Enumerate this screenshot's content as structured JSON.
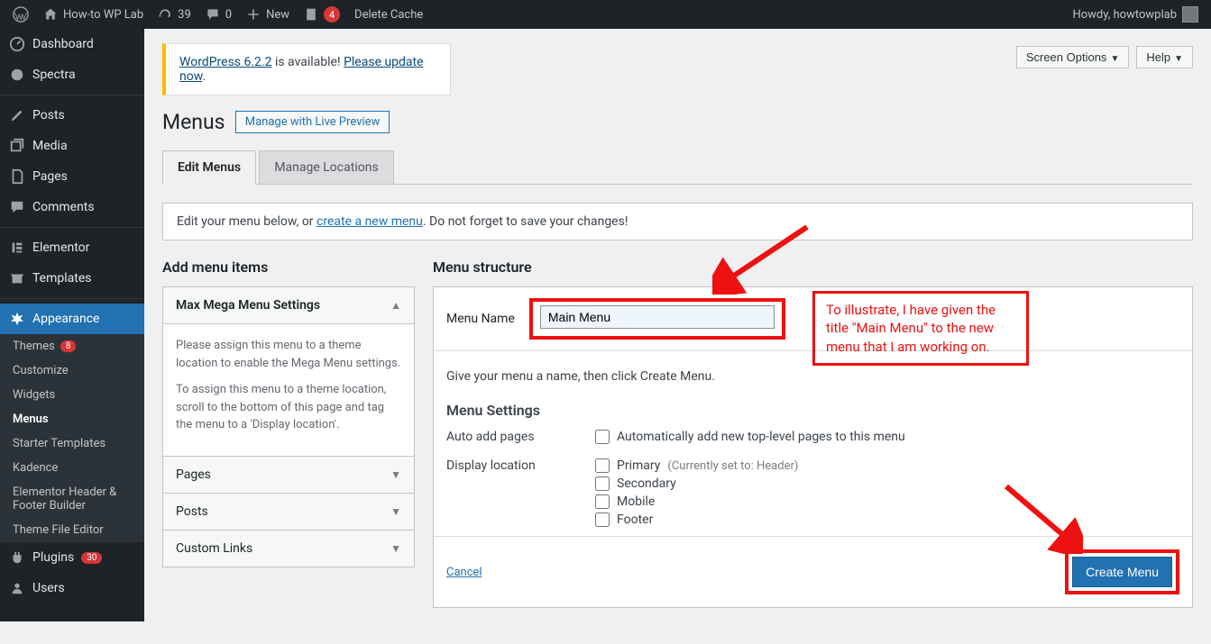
{
  "adminbar": {
    "site": "How-to WP Lab",
    "updates": "39",
    "comments": "0",
    "new": "New",
    "forms_badge": "4",
    "delete_cache": "Delete Cache",
    "howdy": "Howdy, howtowplab"
  },
  "sidebar": {
    "items": [
      {
        "label": "Dashboard"
      },
      {
        "label": "Spectra"
      },
      {
        "label": "Posts"
      },
      {
        "label": "Media"
      },
      {
        "label": "Pages"
      },
      {
        "label": "Comments"
      },
      {
        "label": "Elementor"
      },
      {
        "label": "Templates"
      },
      {
        "label": "Appearance"
      },
      {
        "label": "Plugins"
      },
      {
        "label": "Users"
      }
    ],
    "appearance_sub": [
      {
        "label": "Themes",
        "badge": "8"
      },
      {
        "label": "Customize"
      },
      {
        "label": "Widgets"
      },
      {
        "label": "Menus"
      },
      {
        "label": "Starter Templates"
      },
      {
        "label": "Kadence"
      },
      {
        "label": "Elementor Header & Footer Builder"
      },
      {
        "label": "Theme File Editor"
      }
    ],
    "plugins_badge": "30"
  },
  "top_buttons": {
    "screen_options": "Screen Options",
    "help": "Help"
  },
  "notice": {
    "link1": "WordPress 6.2.2",
    "mid": " is available! ",
    "link2": "Please update now",
    "end": "."
  },
  "page": {
    "title": "Menus",
    "live_preview": "Manage with Live Preview",
    "tabs": {
      "edit": "Edit Menus",
      "locations": "Manage Locations"
    },
    "infobar_pre": "Edit your menu below, or ",
    "infobar_link": "create a new menu",
    "infobar_post": ". Do not forget to save your changes!"
  },
  "left": {
    "title": "Add menu items",
    "mega_head": "Max Mega Menu Settings",
    "mega_p1": "Please assign this menu to a theme location to enable the Mega Menu settings.",
    "mega_p2": "To assign this menu to a theme location, scroll to the bottom of this page and tag the menu to a 'Display location'.",
    "acc": [
      "Pages",
      "Posts",
      "Custom Links"
    ]
  },
  "right": {
    "title": "Menu structure",
    "name_label": "Menu Name",
    "name_value": "Main Menu",
    "instr": "Give your menu a name, then click Create Menu.",
    "settings_title": "Menu Settings",
    "auto_label": "Auto add pages",
    "auto_opt": "Automatically add new top-level pages to this menu",
    "display_label": "Display location",
    "loc": [
      {
        "label": "Primary",
        "hint": "(Currently set to: Header)"
      },
      {
        "label": "Secondary"
      },
      {
        "label": "Mobile"
      },
      {
        "label": "Footer"
      }
    ],
    "cancel": "Cancel",
    "create": "Create Menu"
  },
  "callout": "To illustrate, I have given the title \"Main Menu\" to the new menu that I am working on."
}
